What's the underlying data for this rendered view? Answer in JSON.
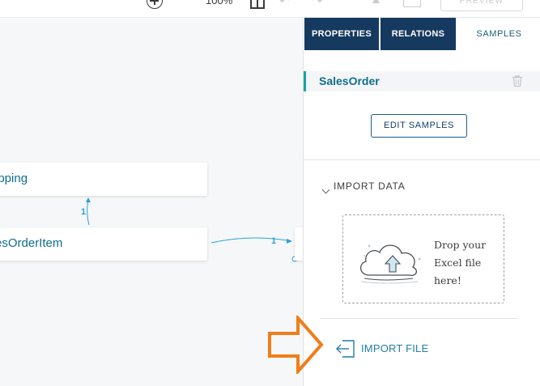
{
  "toolbar": {
    "zoom_level": "100%",
    "preview_label": "PREVIEW"
  },
  "canvas": {
    "entities": [
      {
        "name": "ipping"
      },
      {
        "name": "esOrderItem"
      }
    ],
    "relations": [
      {
        "cardinality": "1"
      },
      {
        "cardinality": "1"
      }
    ]
  },
  "panel": {
    "tabs": [
      {
        "label": "PROPERTIES"
      },
      {
        "label": "RELATIONS"
      },
      {
        "label": "SAMPLES"
      }
    ],
    "selected_entity": "SalesOrder",
    "edit_samples_label": "EDIT SAMPLES",
    "import_section_title": "IMPORT DATA",
    "drop_zone_text": "Drop your Excel file here!",
    "import_file_label": "IMPORT FILE"
  },
  "colors": {
    "tab_active_bg": "#163a5f",
    "accent_teal": "#1aa3a8",
    "link_blue": "#1f7ea6",
    "annotation_orange": "#f07d1a"
  },
  "icons": [
    "zoom-in-icon",
    "layout-icon",
    "undo-icon",
    "redo-icon",
    "flask-icon",
    "table-icon",
    "trash-icon",
    "chevron-down-icon",
    "cloud-upload-icon",
    "import-file-icon",
    "orange-arrow-annotation"
  ]
}
